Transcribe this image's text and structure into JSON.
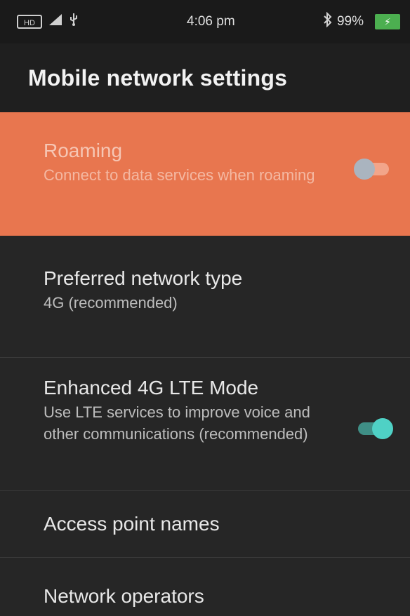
{
  "status_bar": {
    "sim_label": "HD",
    "signal_icon": "cell-signal-icon",
    "usb_icon": "usb-icon",
    "time": "4:06 pm",
    "bluetooth_icon": "bluetooth-icon",
    "battery_percent": "99%",
    "battery_icon": "battery-charging-icon"
  },
  "app_bar": {
    "title": "Mobile network settings"
  },
  "preferences": {
    "roaming": {
      "title": "Roaming",
      "summary": "Connect to data services when roaming",
      "enabled": false
    },
    "network_type": {
      "title": "Preferred network type",
      "summary": "4G (recommended)"
    },
    "lte": {
      "title": "Enhanced 4G LTE Mode",
      "summary": "Use LTE services to improve voice and other communications (recommended)",
      "enabled": true
    },
    "apn": {
      "title": "Access point names"
    },
    "operators": {
      "title": "Network operators"
    }
  },
  "colors": {
    "highlight": "#e8764f",
    "background": "#262626",
    "switch_on": "#4fd1c5"
  }
}
